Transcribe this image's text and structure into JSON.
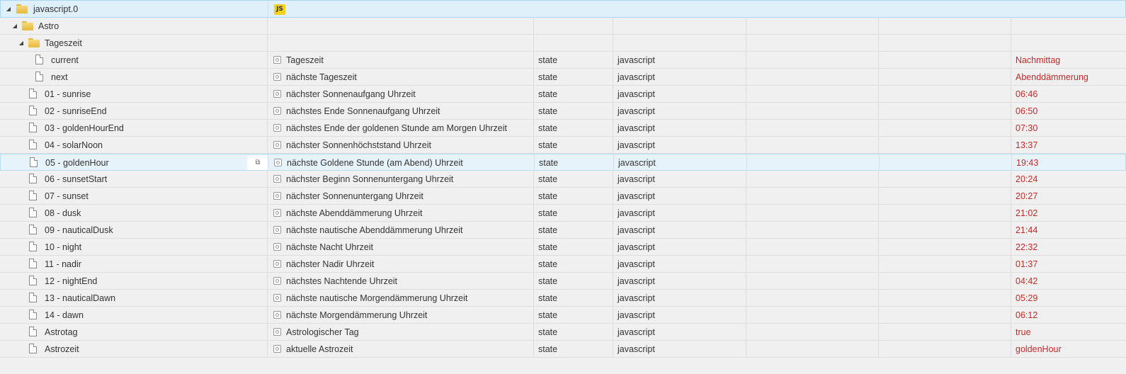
{
  "root": {
    "label": "javascript.0",
    "badge": "JS"
  },
  "astro": {
    "label": "Astro"
  },
  "tageszeit": {
    "label": "Tageszeit"
  },
  "rows": [
    {
      "name": "current",
      "desc": "Tageszeit",
      "type": "state",
      "role": "javascript",
      "value": "Nachmittag",
      "indent": 2
    },
    {
      "name": "next",
      "desc": "nächste Tageszeit",
      "type": "state",
      "role": "javascript",
      "value": "Abenddämmerung",
      "indent": 2
    },
    {
      "name": "01 - sunrise",
      "desc": "nächster Sonnenaufgang Uhrzeit",
      "type": "state",
      "role": "javascript",
      "value": "06:46",
      "indent": 1
    },
    {
      "name": "02 - sunriseEnd",
      "desc": "nächstes Ende Sonnenaufgang Uhrzeit",
      "type": "state",
      "role": "javascript",
      "value": "06:50",
      "indent": 1
    },
    {
      "name": "03 - goldenHourEnd",
      "desc": "nächstes Ende der goldenen Stunde am Morgen Uhrzeit",
      "type": "state",
      "role": "javascript",
      "value": "07:30",
      "indent": 1
    },
    {
      "name": "04 - solarNoon",
      "desc": "nächster Sonnenhöchststand Uhrzeit",
      "type": "state",
      "role": "javascript",
      "value": "13:37",
      "indent": 1
    },
    {
      "name": "05 - goldenHour",
      "desc": "nächste Goldene Stunde (am Abend) Uhrzeit",
      "type": "state",
      "role": "javascript",
      "value": "19:43",
      "indent": 1,
      "hover": true
    },
    {
      "name": "06 - sunsetStart",
      "desc": "nächster Beginn Sonnenuntergang Uhrzeit",
      "type": "state",
      "role": "javascript",
      "value": "20:24",
      "indent": 1
    },
    {
      "name": "07 - sunset",
      "desc": "nächster Sonnenuntergang Uhrzeit",
      "type": "state",
      "role": "javascript",
      "value": "20:27",
      "indent": 1
    },
    {
      "name": "08 - dusk",
      "desc": "nächste Abenddämmerung Uhrzeit",
      "type": "state",
      "role": "javascript",
      "value": "21:02",
      "indent": 1
    },
    {
      "name": "09 - nauticalDusk",
      "desc": "nächste nautische Abenddämmerung Uhrzeit",
      "type": "state",
      "role": "javascript",
      "value": "21:44",
      "indent": 1
    },
    {
      "name": "10 - night",
      "desc": "nächste Nacht Uhrzeit",
      "type": "state",
      "role": "javascript",
      "value": "22:32",
      "indent": 1
    },
    {
      "name": "11 - nadir",
      "desc": "nächster Nadir Uhrzeit",
      "type": "state",
      "role": "javascript",
      "value": "01:37",
      "indent": 1
    },
    {
      "name": "12 - nightEnd",
      "desc": "nächstes Nachtende Uhrzeit",
      "type": "state",
      "role": "javascript",
      "value": "04:42",
      "indent": 1
    },
    {
      "name": "13 - nauticalDawn",
      "desc": "nächste nautische Morgendämmerung Uhrzeit",
      "type": "state",
      "role": "javascript",
      "value": "05:29",
      "indent": 1
    },
    {
      "name": "14 - dawn",
      "desc": "nächste Morgendämmerung Uhrzeit",
      "type": "state",
      "role": "javascript",
      "value": "06:12",
      "indent": 1
    },
    {
      "name": "Astrotag",
      "desc": "Astrologischer Tag",
      "type": "state",
      "role": "javascript",
      "value": "true",
      "indent": 1
    },
    {
      "name": "Astrozeit",
      "desc": "aktuelle Astrozeit",
      "type": "state",
      "role": "javascript",
      "value": "goldenHour",
      "indent": 1
    }
  ],
  "colors": {
    "value": "#c62828",
    "selected_bg": "#dff0fb",
    "js_badge": "#f2d21b"
  },
  "icons": {
    "folder": "folder-icon",
    "file": "file-icon",
    "state": "state-icon",
    "copy": "copy-icon",
    "expand": "collapse-triangle-icon"
  }
}
